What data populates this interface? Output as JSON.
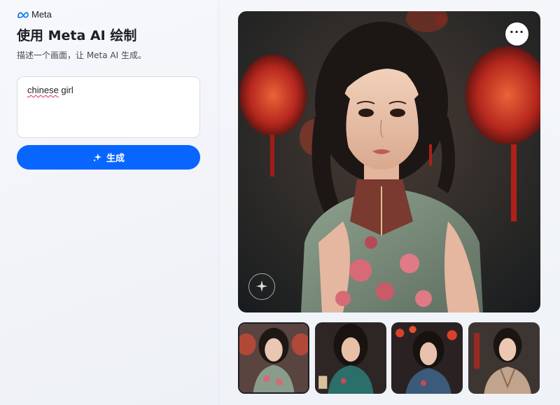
{
  "brand": {
    "name": "Meta"
  },
  "header": {
    "title": "使用 Meta AI 绘制",
    "subtitle": "描述一个画面，让 Meta AI 生成。"
  },
  "prompt": {
    "value_misspelled": "chinese",
    "value_rest": " girl"
  },
  "generate_button": {
    "label": "生成"
  },
  "image_viewer": {
    "more_options_label": "···",
    "selected_index": 0,
    "thumbnail_count": 4
  },
  "colors": {
    "accent": "#0866ff",
    "text": "#1c1e21"
  }
}
